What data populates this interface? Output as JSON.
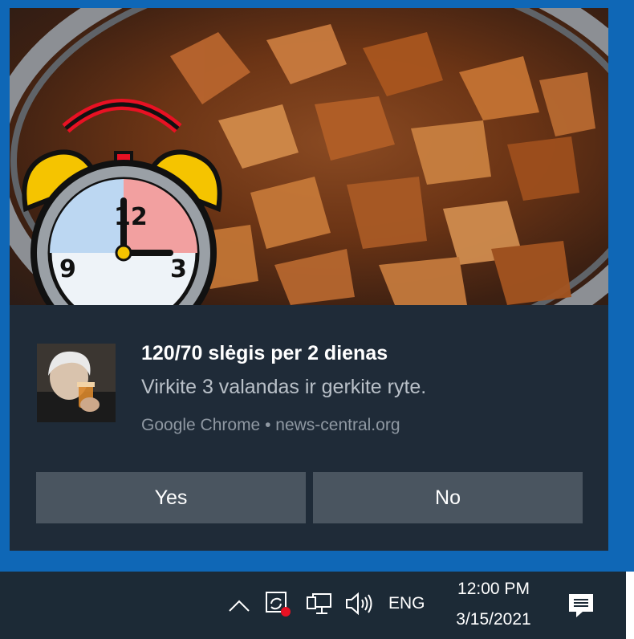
{
  "notification": {
    "title": "120/70 slėgis per 2 dienas",
    "message": "Virkite 3 valandas ir gerkite ryte.",
    "attribution": "Google Chrome • news-central.org",
    "hero_icon": "alarm-clock-icon",
    "avatar_icon": "elderly-woman-drinking-photo",
    "buttons": {
      "yes_label": "Yes",
      "no_label": "No"
    }
  },
  "taskbar": {
    "language": "ENG",
    "time": "12:00 PM",
    "date": "3/15/2021",
    "icons": [
      "chevron-up-icon",
      "sync-app-icon",
      "network-icon",
      "volume-icon",
      "action-center-icon"
    ]
  },
  "colors": {
    "desktop_blue": "#0f67b6",
    "toast_bg": "#1f2b38",
    "button_bg": "#4a5560",
    "taskbar_bg": "#1c2a36",
    "badge_red": "#e81123"
  }
}
